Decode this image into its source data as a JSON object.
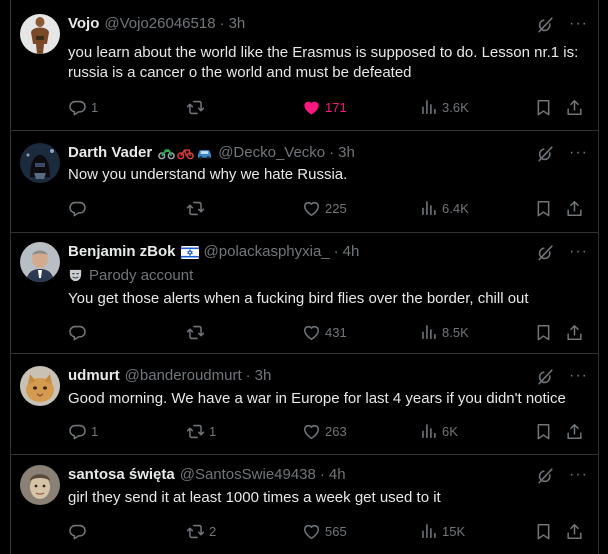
{
  "tweets": [
    {
      "name": "Vojo",
      "handle": "@Vojo26046518",
      "time": "3h",
      "text": "you learn about the world like the Erasmus is supposed to do. Lesson nr.1 is: russia is a cancer o the world and must be defeated",
      "replies": "1",
      "retweets": "",
      "likes": "171",
      "liked": true,
      "views": "3.6K"
    },
    {
      "name": "Darth Vader",
      "handle": "@Decko_Vecko",
      "time": "3h",
      "text": "Now you understand why we hate Russia.",
      "replies": "",
      "retweets": "",
      "likes": "225",
      "views": "6.4K"
    },
    {
      "name": "Benjamin zBok",
      "handle": "@polackasphyxia_",
      "time": "4h",
      "label": "Parody account",
      "text": "You get those alerts when a fucking bird flies over the border, chill out",
      "replies": "",
      "retweets": "",
      "likes": "431",
      "views": "8.5K"
    },
    {
      "name": "udmurt",
      "handle": "@banderoudmurt",
      "time": "3h",
      "text": "Good morning. We have a war in Europe for last 4 years if you didn't notice",
      "replies": "1",
      "retweets": "1",
      "likes": "263",
      "views": "6K"
    },
    {
      "name": "santosa święta",
      "handle": "@SantosSwie49438",
      "time": "4h",
      "text": "girl they send it at least 1000 times a week get used to it",
      "replies": "",
      "retweets": "2",
      "likes": "565",
      "views": "15K"
    }
  ],
  "ui": {
    "separator": "·",
    "more": "···"
  },
  "icons": {
    "reply": "speech-bubble-icon",
    "retweet": "retweet-arrows-icon",
    "like": "heart-icon",
    "views": "bar-chart-icon",
    "bookmark": "bookmark-icon",
    "share": "share-arrow-icon",
    "grok": "grok-slash-icon",
    "more": "more-dots-icon",
    "parody": "theater-mask-icon",
    "emoji": [
      "motorcycle-icon",
      "bicycle-icon",
      "car-icon"
    ],
    "flag": "israel-flag-icon"
  },
  "colors": {
    "background": "#000000",
    "border": "#2f3336",
    "primary_text": "#e7e9ea",
    "secondary_text": "#71767b",
    "like_active": "#f91880"
  }
}
